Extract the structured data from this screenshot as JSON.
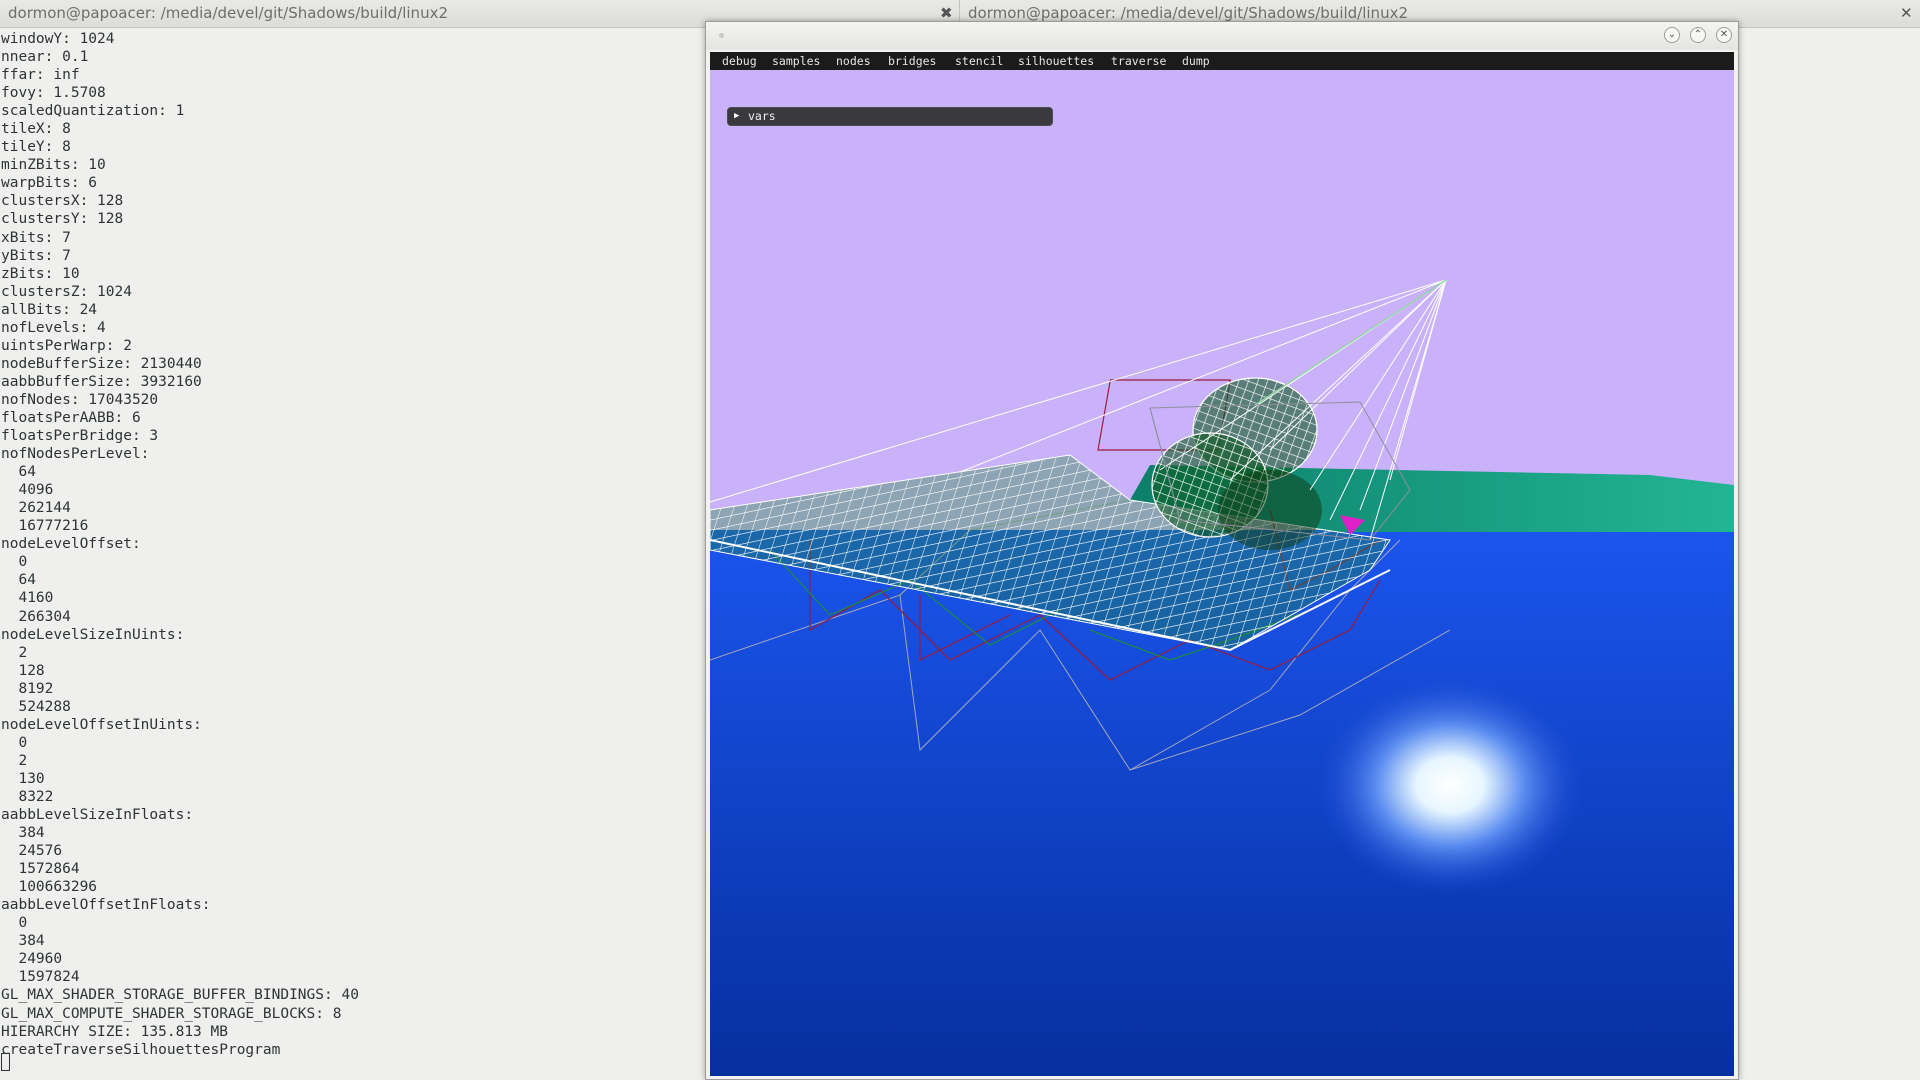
{
  "terminal": {
    "tabs": [
      {
        "title": "dormon@papoacer: /media/devel/git/Shadows/build/linux2",
        "close": "✖"
      },
      {
        "title": "dormon@papoacer: /media/devel/git/Shadows/build/linux2",
        "close": "✕"
      }
    ],
    "lines": [
      "windowY: 1024",
      "nnear: 0.1",
      "ffar: inf",
      "fovy: 1.5708",
      "scaledQuantization: 1",
      "tileX: 8",
      "tileY: 8",
      "minZBits: 10",
      "warpBits: 6",
      "clustersX: 128",
      "clustersY: 128",
      "xBits: 7",
      "yBits: 7",
      "zBits: 10",
      "clustersZ: 1024",
      "allBits: 24",
      "nofLevels: 4",
      "uintsPerWarp: 2",
      "nodeBufferSize: 2130440",
      "aabbBufferSize: 3932160",
      "nofNodes: 17043520",
      "floatsPerAABB: 6",
      "floatsPerBridge: 3",
      "nofNodesPerLevel:",
      "  64",
      "  4096",
      "  262144",
      "  16777216",
      "nodeLevelOffset:",
      "  0",
      "  64",
      "  4160",
      "  266304",
      "nodeLevelSizeInUints:",
      "  2",
      "  128",
      "  8192",
      "  524288",
      "nodeLevelOffsetInUints:",
      "  0",
      "  2",
      "  130",
      "  8322",
      "aabbLevelSizeInFloats:",
      "  384",
      "  24576",
      "  1572864",
      "  100663296",
      "aabbLevelOffsetInFloats:",
      "  0",
      "  384",
      "  24960",
      "  1597824",
      "GL_MAX_SHADER_STORAGE_BUFFER_BINDINGS: 40",
      "GL_MAX_COMPUTE_SHADER_STORAGE_BLOCKS: 8",
      "HIERARCHY SIZE: 135.813 MB",
      "createTraverseSilhouettesProgram"
    ]
  },
  "app_window": {
    "controls": {
      "minimize": "⌄",
      "maximize": "⌃",
      "close": "✕"
    },
    "menu": [
      "debug",
      "samples",
      "nodes",
      "bridges",
      "stencil",
      "silhouettes",
      "traverse",
      "dump"
    ],
    "vars_panel": {
      "arrow": "▶",
      "label": "vars"
    },
    "colors": {
      "sky": "#cab2fb",
      "ground_blue": "#0b3ec7",
      "ground_teal": "#1aa48a",
      "wireframe": "#ffffff",
      "wire_green": "#1f8f2f",
      "wire_red": "#9b1a3a",
      "frustum_gray": "#9a9aa6"
    }
  }
}
